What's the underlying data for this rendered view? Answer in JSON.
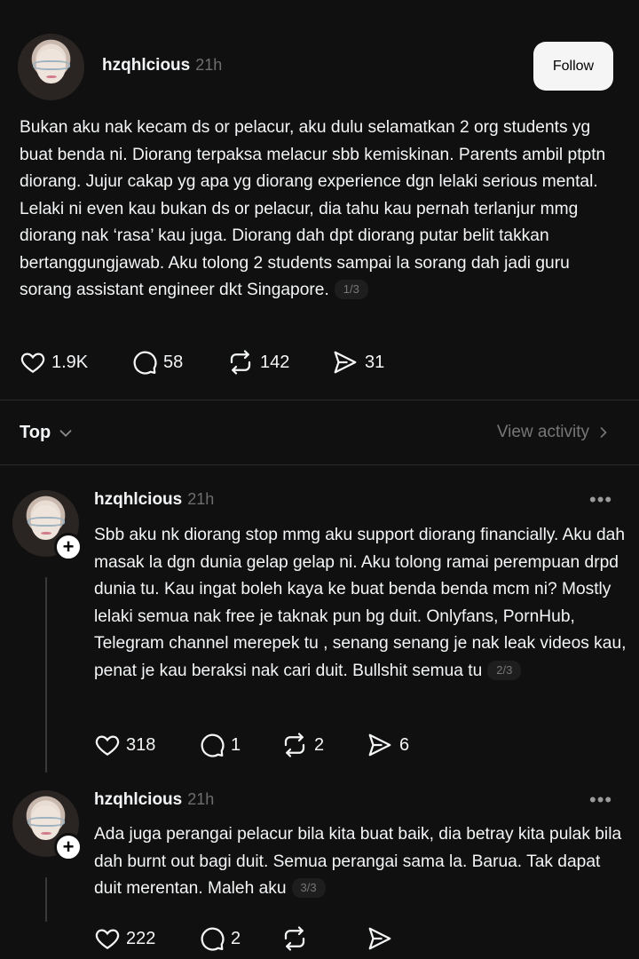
{
  "post": {
    "username": "hzqhlcious",
    "time": "21h",
    "follow_label": "Follow",
    "text": "Bukan aku nak kecam ds or pelacur,  aku dulu selamatkan 2 org students yg buat benda ni. Diorang terpaksa melacur sbb kemiskinan. Parents ambil ptptn diorang. Jujur cakap yg apa yg diorang experience dgn lelaki serious mental. Lelaki ni even kau bukan ds or pelacur, dia tahu kau pernah terlanjur mmg diorang nak ‘rasa’ kau juga. Diorang dah dpt  diorang putar belit takkan bertanggungjawab. Aku tolong 2 students sampai la sorang dah jadi guru sorang assistant engineer dkt Singapore.",
    "pager": "1/3",
    "likes": "1.9K",
    "comments": "58",
    "reposts": "142",
    "shares": "31"
  },
  "sort_bar": {
    "sort_label": "Top",
    "view_activity_label": "View activity"
  },
  "replies": [
    {
      "username": "hzqhlcious",
      "time": "21h",
      "text": "Sbb aku nk diorang stop mmg aku support diorang financially. Aku dah masak la dgn dunia gelap gelap ni. Aku tolong ramai perempuan drpd dunia tu. Kau ingat boleh kaya ke buat benda benda mcm ni? Mostly lelaki semua nak free je taknak pun bg duit. Onlyfans, PornHub, Telegram channel merepek tu , senang senang je nak leak videos kau, penat je kau beraksi nak cari duit. Bullshit semua tu",
      "pager": "2/3",
      "likes": "318",
      "comments": "1",
      "reposts": "2",
      "shares": "6"
    },
    {
      "username": "hzqhlcious",
      "time": "21h",
      "text": "Ada juga perangai pelacur bila kita buat baik, dia betray kita pulak bila dah burnt out bagi duit. Semua perangai sama la. Barua. Tak dapat duit merentan. Maleh aku",
      "pager": "3/3",
      "likes": "222",
      "comments": "2",
      "reposts": "",
      "shares": ""
    }
  ],
  "icons": {
    "like": "heart-icon",
    "comment": "comment-bubble-icon",
    "repost": "repost-icon",
    "share": "send-icon",
    "more": "more-horizontal-icon",
    "follow_plus": "plus-icon",
    "sort_chevron": "chevron-down-icon",
    "activity_chevron": "chevron-right-icon"
  }
}
